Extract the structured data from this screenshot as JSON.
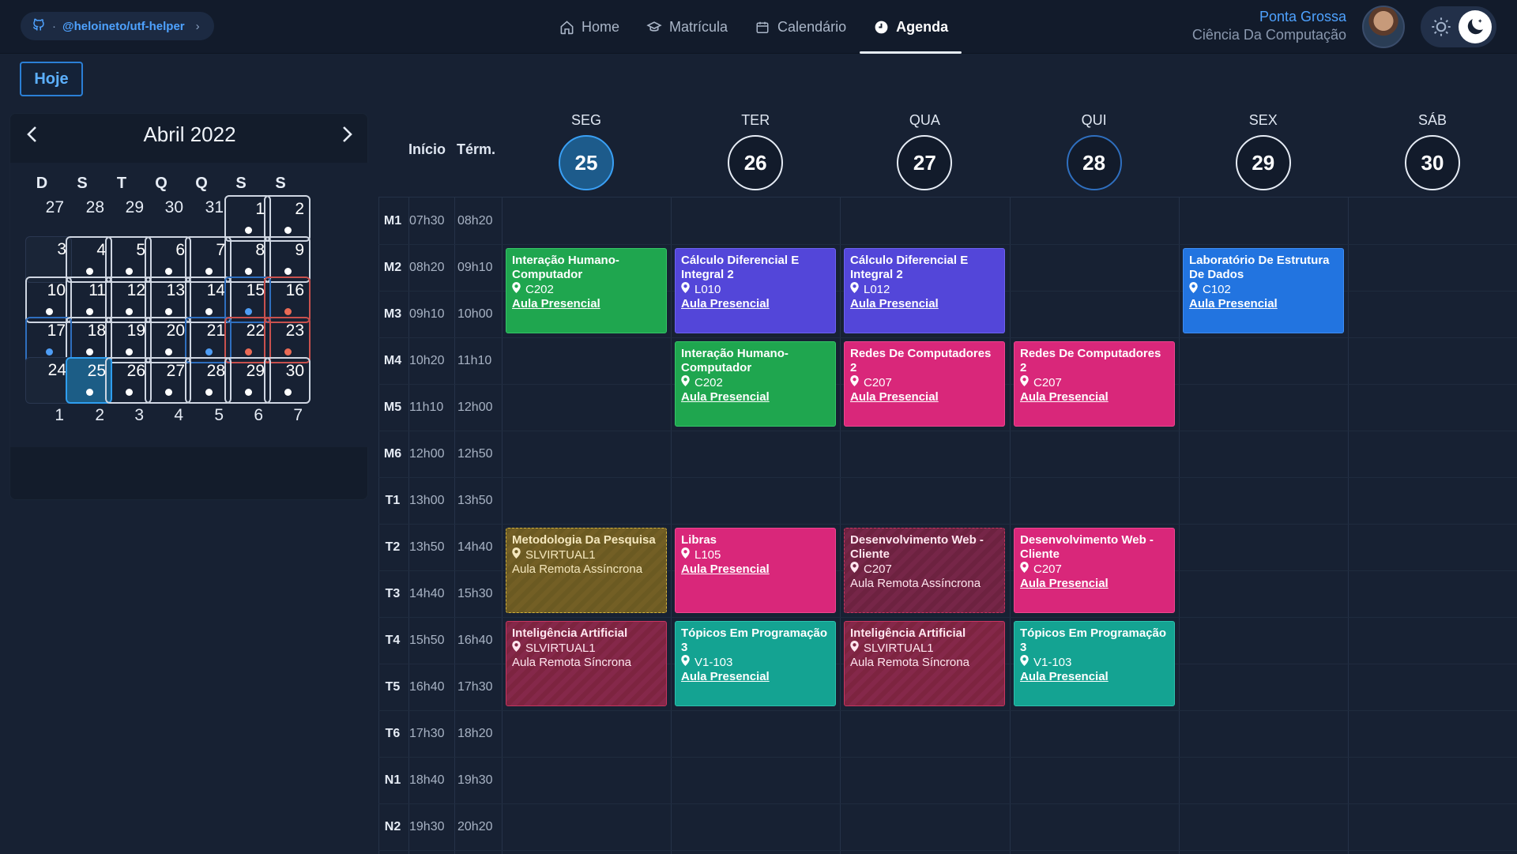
{
  "topbar": {
    "repo": "@heloineto/utf-helper",
    "nav": [
      {
        "label": "Home",
        "icon": "home-icon"
      },
      {
        "label": "Matrícula",
        "icon": "graduation-cap-icon"
      },
      {
        "label": "Calendário",
        "icon": "calendar-icon"
      },
      {
        "label": "Agenda",
        "icon": "clock-icon",
        "active": true
      }
    ],
    "campus": "Ponta Grossa",
    "course": "Ciência Da Computação"
  },
  "today_button": "Hoje",
  "mini_calendar": {
    "title": "Abril 2022",
    "weekdays": [
      "D",
      "S",
      "T",
      "Q",
      "Q",
      "S",
      "S"
    ],
    "weeks": [
      [
        "27",
        "28",
        "29",
        "30",
        "31",
        "1",
        "2"
      ],
      [
        "3",
        "4",
        "5",
        "6",
        "7",
        "8",
        "9"
      ],
      [
        "10",
        "11",
        "12",
        "13",
        "14",
        "15",
        "16"
      ],
      [
        "17",
        "18",
        "19",
        "20",
        "21",
        "22",
        "23"
      ],
      [
        "24",
        "25",
        "26",
        "27",
        "28",
        "29",
        "30"
      ],
      [
        "1",
        "2",
        "3",
        "4",
        "5",
        "6",
        "7"
      ]
    ]
  },
  "schedule": {
    "col_start": "Início",
    "col_end": "Térm.",
    "days": [
      {
        "name": "SEG",
        "num": "25"
      },
      {
        "name": "TER",
        "num": "26"
      },
      {
        "name": "QUA",
        "num": "27"
      },
      {
        "name": "QUI",
        "num": "28"
      },
      {
        "name": "SEX",
        "num": "29"
      },
      {
        "name": "SÁB",
        "num": "30"
      }
    ],
    "slots": [
      {
        "code": "M1",
        "start": "07h30",
        "end": "08h20"
      },
      {
        "code": "M2",
        "start": "08h20",
        "end": "09h10"
      },
      {
        "code": "M3",
        "start": "09h10",
        "end": "10h00"
      },
      {
        "code": "M4",
        "start": "10h20",
        "end": "11h10"
      },
      {
        "code": "M5",
        "start": "11h10",
        "end": "12h00"
      },
      {
        "code": "M6",
        "start": "12h00",
        "end": "12h50"
      },
      {
        "code": "T1",
        "start": "13h00",
        "end": "13h50"
      },
      {
        "code": "T2",
        "start": "13h50",
        "end": "14h40"
      },
      {
        "code": "T3",
        "start": "14h40",
        "end": "15h30"
      },
      {
        "code": "T4",
        "start": "15h50",
        "end": "16h40"
      },
      {
        "code": "T5",
        "start": "16h40",
        "end": "17h30"
      },
      {
        "code": "T6",
        "start": "17h30",
        "end": "18h20"
      },
      {
        "code": "N1",
        "start": "18h40",
        "end": "19h30"
      },
      {
        "code": "N2",
        "start": "19h30",
        "end": "20h20"
      }
    ],
    "events": [
      {
        "day": 0,
        "slot": 1,
        "span": 2,
        "color": "green",
        "title": "Interação Humano-Computador",
        "room": "C202",
        "mode": "Aula Presencial"
      },
      {
        "day": 1,
        "slot": 1,
        "span": 2,
        "color": "purple",
        "title": "Cálculo Diferencial E Integral 2",
        "room": "L010",
        "mode": "Aula Presencial"
      },
      {
        "day": 2,
        "slot": 1,
        "span": 2,
        "color": "purple",
        "title": "Cálculo Diferencial E Integral 2",
        "room": "L012",
        "mode": "Aula Presencial"
      },
      {
        "day": 4,
        "slot": 1,
        "span": 2,
        "color": "blue",
        "title": "Laboratório De Estrutura De Dados",
        "room": "C102",
        "mode": "Aula Presencial"
      },
      {
        "day": 1,
        "slot": 3,
        "span": 2,
        "color": "green",
        "title": "Interação Humano-Computador",
        "room": "C202",
        "mode": "Aula Presencial"
      },
      {
        "day": 2,
        "slot": 3,
        "span": 2,
        "color": "pink",
        "title": "Redes De Computadores 2",
        "room": "C207",
        "mode": "Aula Presencial"
      },
      {
        "day": 3,
        "slot": 3,
        "span": 2,
        "color": "pink",
        "title": "Redes De Computadores 2",
        "room": "C207",
        "mode": "Aula Presencial"
      },
      {
        "day": 0,
        "slot": 7,
        "span": 2,
        "color": "olive",
        "title": "Metodologia Da Pesquisa",
        "room": "SLVIRTUAL1",
        "mode": "Aula Remota Assíncrona"
      },
      {
        "day": 1,
        "slot": 7,
        "span": 2,
        "color": "pink",
        "title": "Libras",
        "room": "L105",
        "mode": "Aula Presencial"
      },
      {
        "day": 2,
        "slot": 7,
        "span": 2,
        "color": "maroon-dash",
        "title": "Desenvolvimento Web - Cliente",
        "room": "C207",
        "mode": "Aula Remota Assíncrona"
      },
      {
        "day": 3,
        "slot": 7,
        "span": 2,
        "color": "pink",
        "title": "Desenvolvimento Web - Cliente",
        "room": "C207",
        "mode": "Aula Presencial"
      },
      {
        "day": 0,
        "slot": 9,
        "span": 2,
        "color": "maroon",
        "title": "Inteligência Artificial",
        "room": "SLVIRTUAL1",
        "mode": "Aula Remota Síncrona"
      },
      {
        "day": 1,
        "slot": 9,
        "span": 2,
        "color": "teal",
        "title": "Tópicos Em Programação 3",
        "room": "V1-103",
        "mode": "Aula Presencial"
      },
      {
        "day": 2,
        "slot": 9,
        "span": 2,
        "color": "maroon",
        "title": "Inteligência Artificial",
        "room": "SLVIRTUAL1",
        "mode": "Aula Remota Síncrona"
      },
      {
        "day": 3,
        "slot": 9,
        "span": 2,
        "color": "teal",
        "title": "Tópicos Em Programação 3",
        "room": "V1-103",
        "mode": "Aula Presencial"
      }
    ]
  }
}
